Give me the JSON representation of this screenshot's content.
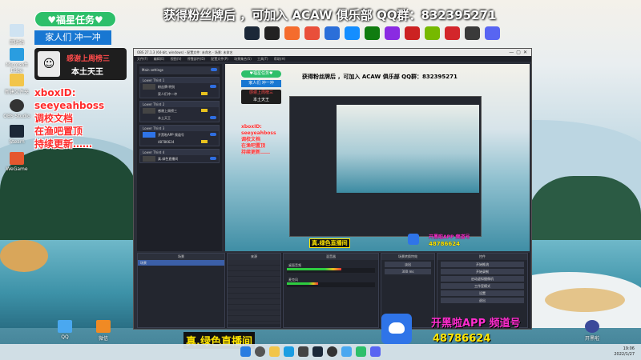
{
  "overlay": {
    "green_badge": "♥福星任务♥",
    "blue_badge": "家人们 冲一冲",
    "bang_line1": "感谢上周榜三",
    "bang_line2": "本土天王",
    "red_lines": [
      "xboxID:",
      "seeyeahboss",
      "调校文档",
      "在渔吧置顶",
      "持续更新……"
    ],
    "top_banner": "获得粉丝牌后 ，可加入 ACAW 俱乐部 QQ群：832395271",
    "channel_label": "真.绿色直播间",
    "app_label": "开黑啦APP 频道号",
    "channel_number": "48786624"
  },
  "obs": {
    "title": "OBS 27.1.3 (64-bit, windows) - 配置文件: 未命名 - 场景: 未命名",
    "menu": [
      "文件(F)",
      "编辑(E)",
      "视图(V)",
      "停靠部件(D)",
      "配置文件(P)",
      "场景集合(S)",
      "工具(T)",
      "帮助(H)"
    ],
    "sidebar": {
      "top_items": [
        "Main settings"
      ],
      "layers": [
        {
          "header": "Lower Third 1",
          "rows": [
            "粉丝牌·特别",
            "家人们冲一冲"
          ]
        },
        {
          "header": "Lower Third 2",
          "rows": [
            "感谢上周榜三",
            "本土天王"
          ]
        },
        {
          "header": "Lower Third 3",
          "rows": [
            "开黑啦APP 频道号",
            "48786624"
          ]
        },
        {
          "header": "Lower Third 4",
          "rows": [
            "真.绿色直播间"
          ]
        }
      ]
    },
    "panels": {
      "scenes_title": "场景",
      "sources_title": "来源",
      "mixer_title": "混音器",
      "transitions_title": "场景转换特效",
      "controls_title": "控件",
      "scene_items": [
        "场景"
      ],
      "mixer_tracks": [
        {
          "name": "桌面音频",
          "level": 0.62
        },
        {
          "name": "麦克风",
          "level": 0.35
        }
      ],
      "transition_value": "淡出",
      "duration_value": "300 ms",
      "controls": [
        "开始推流",
        "开始录制",
        "启动虚拟摄像机",
        "工作室模式",
        "设置",
        "退出"
      ]
    }
  },
  "desktop_icons": [
    "回收站",
    "Microsoft Edge",
    "新建文件夹",
    "OBS Studio",
    "Steam",
    "WeGame",
    "QQ",
    "微信",
    "开黑啦"
  ],
  "top_icons": [
    "steam-icon",
    "epic-icon",
    "origin-icon",
    "wegame-icon",
    "uplay-icon",
    "battlenet-icon",
    "xbox-icon",
    "gog-icon",
    "ea-icon",
    "nvidia-icon",
    "msi-icon",
    "obs-icon",
    "discord-icon"
  ],
  "taskbar": {
    "time": "19:06",
    "date": "2022/1/27"
  },
  "colors": {
    "accent_green": "#2dbf6a",
    "accent_blue": "#1877d2",
    "text_red": "#ff2d2d",
    "text_pink": "#ff2dcf",
    "text_yellow": "#ffe500"
  }
}
